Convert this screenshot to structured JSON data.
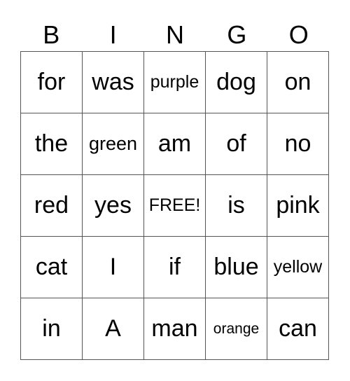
{
  "header": [
    "B",
    "I",
    "N",
    "G",
    "O"
  ],
  "cells": [
    [
      "for",
      "was",
      "purple",
      "dog",
      "on"
    ],
    [
      "the",
      "green",
      "am",
      "of",
      "no"
    ],
    [
      "red",
      "yes",
      "FREE!",
      "is",
      "pink"
    ],
    [
      "cat",
      "I",
      "if",
      "blue",
      "yellow"
    ],
    [
      "in",
      "A",
      "man",
      "orange",
      "can"
    ]
  ]
}
